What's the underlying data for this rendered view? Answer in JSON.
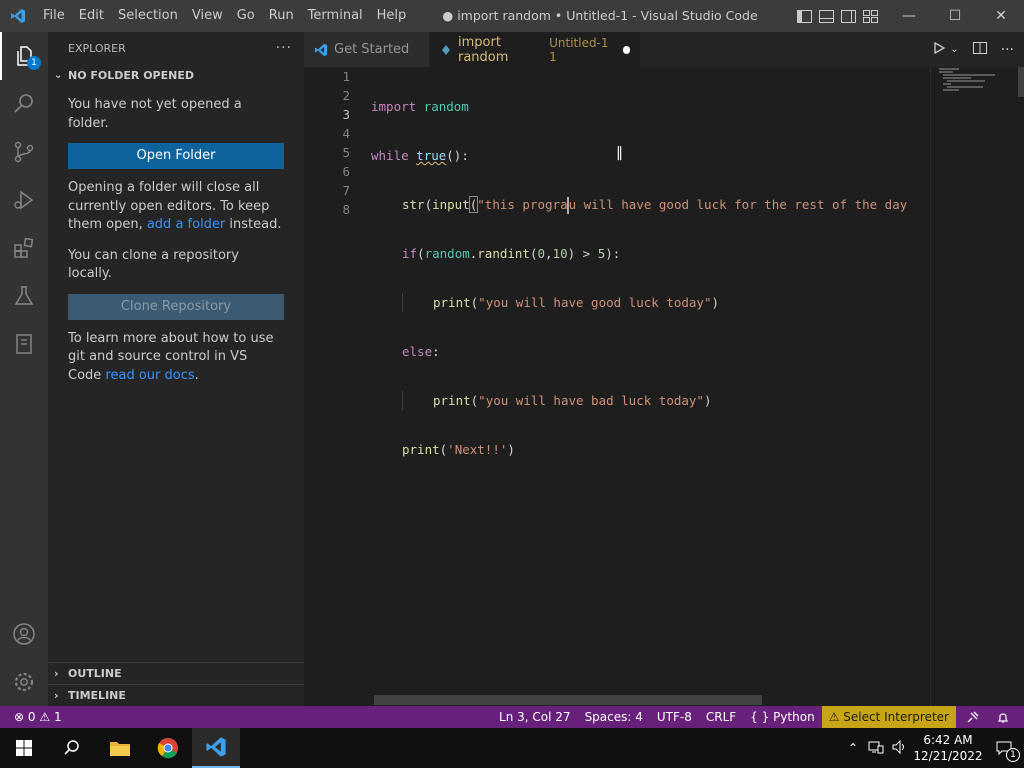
{
  "window": {
    "title": "● import random • Untitled-1 - Visual Studio Code",
    "menu": [
      "File",
      "Edit",
      "Selection",
      "View",
      "Go",
      "Run",
      "Terminal",
      "Help"
    ]
  },
  "activity": {
    "explorer_badge": "1"
  },
  "sidebar": {
    "header": "EXPLORER",
    "more": "···",
    "section_title": "NO FOLDER OPENED",
    "msg_no_folder": "You have not yet opened a folder.",
    "open_folder_label": "Open Folder",
    "msg_opening_pre": "Opening a folder will close all currently open editors. To keep them open, ",
    "msg_opening_link": "add a folder",
    "msg_opening_post": " instead.",
    "msg_clone": "You can clone a repository locally.",
    "clone_label": "Clone Repository",
    "msg_learn_pre": "To learn more about how to use git and source control in VS Code ",
    "msg_learn_link": "read our docs",
    "msg_learn_post": ".",
    "outline": "OUTLINE",
    "timeline": "TIMELINE"
  },
  "tabs": {
    "tab1": "Get Started",
    "tab2_label": "import random",
    "tab2_desc": "Untitled-1 1"
  },
  "editor": {
    "line_numbers": [
      "1",
      "2",
      "3",
      "4",
      "5",
      "6",
      "7",
      "8"
    ],
    "l1_kw": "import",
    "l1_mod": " random",
    "l2_kw": "while",
    "l2_sp": " ",
    "l2_true": "true",
    "l2_end": "():",
    "l3_fn": "str",
    "l3_p1": "(",
    "l3_fn2": "input",
    "l3_p2": "(",
    "l3_str_a": "\"this progra",
    "l3_str_b": "u will have good luck for the rest of the day",
    "l4_kw": "if",
    "l4_p": "(",
    "l4_mod": "random",
    "l4_dot": ".",
    "l4_fn": "randint",
    "l4_p2": "(",
    "l4_n1": "0",
    "l4_c": ",",
    "l4_n2": "10",
    "l4_p3": ") > ",
    "l4_n3": "5",
    "l4_end": "):",
    "l5_fn": "print",
    "l5_p": "(",
    "l5_str": "\"you will have good luck today\"",
    "l5_end": ")",
    "l6_kw": "else",
    "l6_end": ":",
    "l7_fn": "print",
    "l7_p": "(",
    "l7_str": "\"you will have bad luck today\"",
    "l7_end": ")",
    "l8_fn": "print",
    "l8_p": "(",
    "l8_str": "'Next!!'",
    "l8_end": ")"
  },
  "status": {
    "errors": "0",
    "warnings": "1",
    "position": "Ln 3, Col 27",
    "spaces": "Spaces: 4",
    "encoding": "UTF-8",
    "eol": "CRLF",
    "language": "Python",
    "interpreter": "Select Interpreter"
  },
  "taskbar": {
    "time": "6:42 AM",
    "date": "12/21/2022",
    "notif_count": "1"
  }
}
